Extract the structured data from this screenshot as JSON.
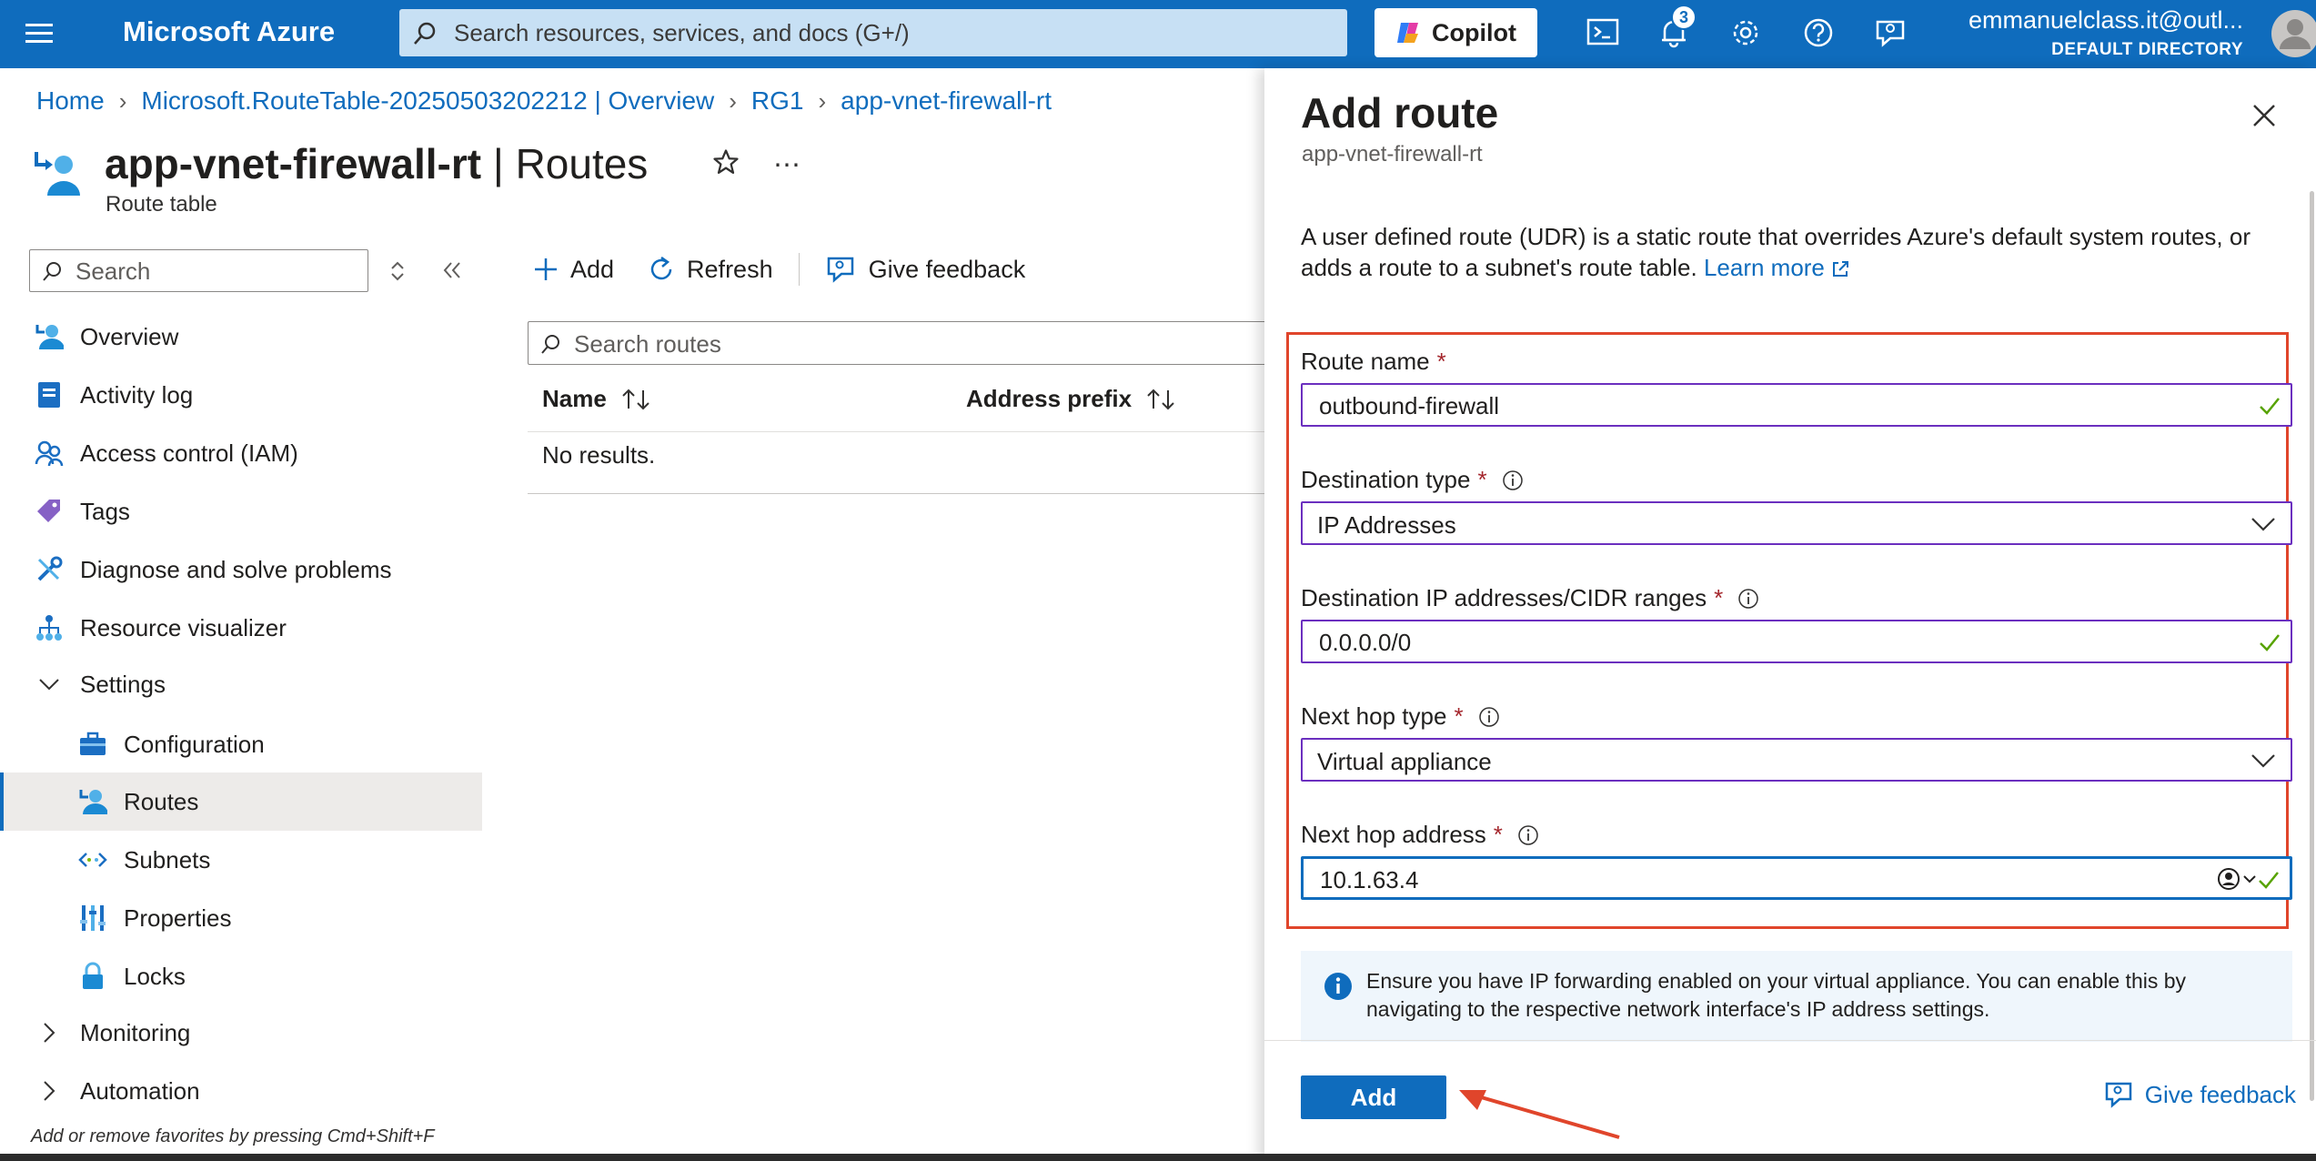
{
  "topbar": {
    "brand": "Microsoft Azure",
    "search_placeholder": "Search resources, services, and docs (G+/)",
    "copilot_label": "Copilot",
    "notification_count": "3",
    "user_email": "emmanuelclass.it@outl...",
    "user_directory": "DEFAULT DIRECTORY",
    "accent_color": "#0f6cbd"
  },
  "breadcrumb": [
    "Home",
    "Microsoft.RouteTable-20250503202212 | Overview",
    "RG1",
    "app-vnet-firewall-rt"
  ],
  "page": {
    "title_resource": "app-vnet-firewall-rt",
    "title_separator": "|",
    "title_section": "Routes",
    "subtitle": "Route table"
  },
  "nav": {
    "search_placeholder": "Search",
    "items": [
      {
        "label": "Overview",
        "icon": "overview-icon"
      },
      {
        "label": "Activity log",
        "icon": "activity-log-icon"
      },
      {
        "label": "Access control (IAM)",
        "icon": "iam-icon"
      },
      {
        "label": "Tags",
        "icon": "tag-icon"
      },
      {
        "label": "Diagnose and solve problems",
        "icon": "wrench-icon"
      },
      {
        "label": "Resource visualizer",
        "icon": "visualizer-icon"
      },
      {
        "label": "Settings",
        "icon": "chevron-down-icon"
      },
      {
        "label": "Configuration",
        "icon": "configuration-icon"
      },
      {
        "label": "Routes",
        "icon": "routes-icon"
      },
      {
        "label": "Subnets",
        "icon": "subnets-icon"
      },
      {
        "label": "Properties",
        "icon": "properties-icon"
      },
      {
        "label": "Locks",
        "icon": "lock-icon"
      },
      {
        "label": "Monitoring",
        "icon": "chevron-right-icon"
      },
      {
        "label": "Automation",
        "icon": "chevron-right-icon"
      }
    ],
    "active_item": "Routes",
    "footer": "Add or remove favorites by pressing Cmd+Shift+F"
  },
  "toolbar": {
    "add_label": "Add",
    "refresh_label": "Refresh",
    "feedback_label": "Give feedback"
  },
  "routes": {
    "search_placeholder": "Search routes",
    "columns": [
      "Name",
      "Address prefix"
    ],
    "empty_text": "No results."
  },
  "panel": {
    "title": "Add route",
    "subtitle": "app-vnet-firewall-rt",
    "description": "A user defined route (UDR) is a static route that overrides Azure's default system routes, or adds a route to a subnet's route table.",
    "learn_more": "Learn more",
    "fields": {
      "route_name": {
        "label": "Route name",
        "value": "outbound-firewall"
      },
      "destination_type": {
        "label": "Destination type",
        "value": "IP Addresses"
      },
      "destination_ips": {
        "label": "Destination IP addresses/CIDR ranges",
        "value": "0.0.0.0/0"
      },
      "next_hop_type": {
        "label": "Next hop type",
        "value": "Virtual appliance"
      },
      "next_hop_address": {
        "label": "Next hop address",
        "value": "10.1.63.4"
      }
    },
    "required_mark": "*",
    "info_text": "Ensure you have IP forwarding enabled on your virtual appliance. You can enable this by navigating to the respective network interface's IP address settings.",
    "add_button": "Add",
    "feedback_label": "Give feedback",
    "highlight_color": "#e0452b"
  }
}
